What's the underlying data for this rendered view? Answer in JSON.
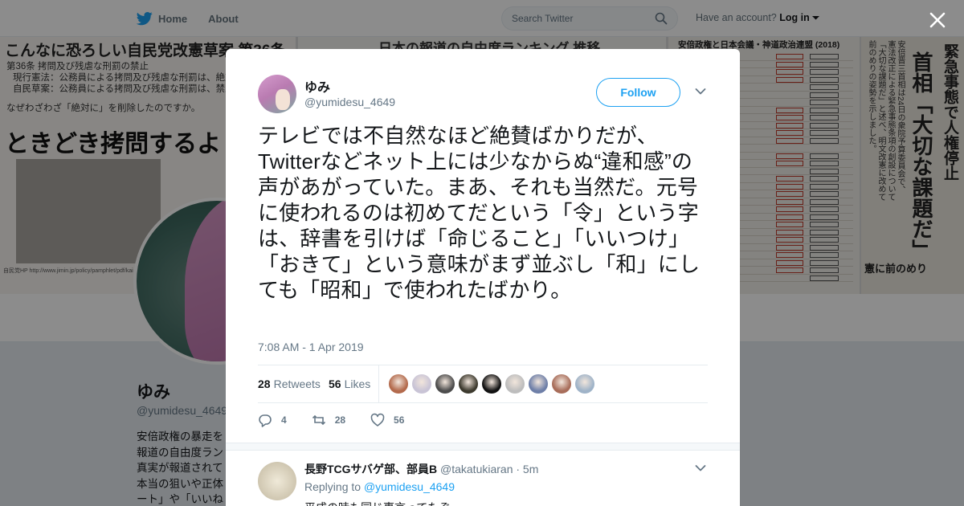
{
  "nav": {
    "home_label": "Home",
    "about_label": "About",
    "search_placeholder": "Search Twitter",
    "account_prompt": "Have an account?",
    "login_label": "Log in"
  },
  "background": {
    "banner_panels": {
      "panel1": {
        "headline": "こんなに恐ろしい自民党改憲草案 第36条",
        "line1": "第36条 拷問及び残虐な刑罰の禁止",
        "line2": "現行憲法：公務員による拷問及び残虐な刑罰は、絶対",
        "line3": "自民草案：公務員による拷問及び残虐な刑罰は、禁止",
        "line4": "なぜわざわざ「絶対に」を削除したのですか。",
        "big": "ときどき拷問するよ",
        "footer": "自民党HP http://www.jimin.jp/policy/pamphlet/pdf/kai"
      },
      "panel2": {
        "headline": "日本の報道の自由度ランキング 推移"
      },
      "panel3": {
        "headline": "安倍政権と日本会議・神道政治連盟 (2018)"
      },
      "panel4": {
        "vertical1": "緊急事態で人権停止",
        "vertical2": "首相「大切な課題だ」",
        "vertical3": "安倍晋三首相は24日の衆院予算委員会で、憲法改正による緊急事態条項の創設について「大切な課題だ」と述べ、明文改憲に改めて前のめりの姿勢を示しました。",
        "bottom": "憲に前のめり"
      }
    },
    "profile": {
      "name": "ゆみ",
      "handle": "@yumidesu_4649",
      "bio": [
        "安倍政権の暴走を",
        "報道の自由度ラン",
        "真実が報道されて",
        "本当の狙いや正体",
        "ート」や「いいね"
      ]
    }
  },
  "tweet": {
    "author_name": "ゆみ",
    "author_handle": "@yumidesu_4649",
    "follow_label": "Follow",
    "text": "テレビでは不自然なほど絶賛ばかりだが、Twitterなどネット上には少なからぬ“違和感”の声があがっていた。まあ、それも当然だ。元号に使われるのは初めてだという「令」という字は、辞書を引けば「命じること」「いいつけ」「おきて」という意味がまず並ぶし「和」にしても「昭和」で使われたばかり。",
    "timestamp": "7:08 AM - 1 Apr 2019",
    "retweets_count": "28",
    "retweets_label": "Retweets",
    "likes_count": "56",
    "likes_label": "Likes",
    "liker_colors": [
      "#b36a4c",
      "#c9c4d6",
      "#4c4c4c",
      "#3d3a2e",
      "#111111",
      "#bdbdbd",
      "#6e7fa8",
      "#a86d5a",
      "#9fb3c8"
    ],
    "actions": {
      "reply_count": "4",
      "retweet_count": "28",
      "like_count": "56"
    }
  },
  "reply": {
    "name": "長野TCGサバゲ部、部員B",
    "handle": "@takatukiaran",
    "time": "· 5m",
    "replying_prefix": "Replying to",
    "replying_to": "@yumidesu_4649",
    "text": "平成の時も同じ事言ってたぞ"
  },
  "colors": {
    "accent": "#1da1f2",
    "text_primary": "#14171a",
    "text_secondary": "#657786",
    "background": "#e6ecf0"
  }
}
